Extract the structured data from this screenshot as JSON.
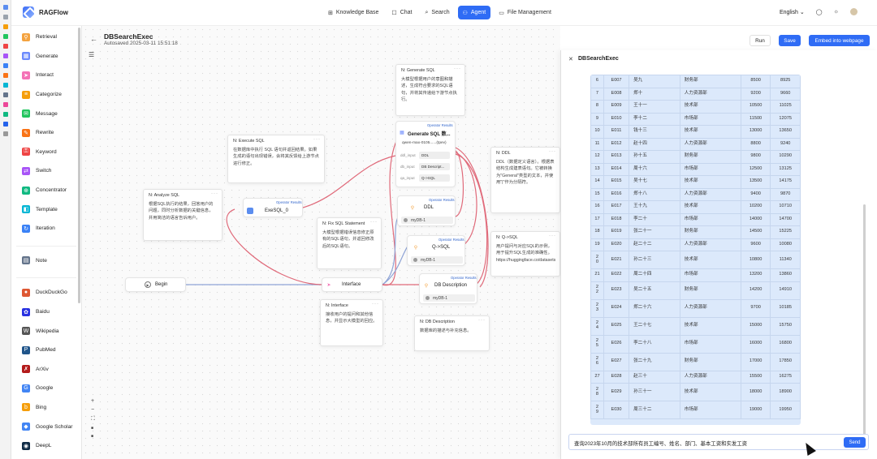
{
  "app": {
    "name": "RAGFlow"
  },
  "nav": [
    {
      "label": "Knowledge Base",
      "icon": "knowledge-base-icon",
      "active": false
    },
    {
      "label": "Chat",
      "icon": "chat-icon",
      "active": false
    },
    {
      "label": "Search",
      "icon": "search-icon",
      "active": false
    },
    {
      "label": "Agent",
      "icon": "agent-icon",
      "active": true
    },
    {
      "label": "File Management",
      "icon": "file-icon",
      "active": false
    }
  ],
  "header_right": {
    "language": "English"
  },
  "sidebar": {
    "items": [
      {
        "label": "Retrieval",
        "color": "#f4a340",
        "glyph": "⚲"
      },
      {
        "label": "Generate",
        "color": "#6b8afd",
        "glyph": "▦"
      },
      {
        "label": "Interact",
        "color": "#f472b6",
        "glyph": "➤"
      },
      {
        "label": "Categorize",
        "color": "#f59e0b",
        "glyph": "≡"
      },
      {
        "label": "Message",
        "color": "#22c55e",
        "glyph": "✉"
      },
      {
        "label": "Rewrite",
        "color": "#f97316",
        "glyph": "✎"
      },
      {
        "label": "Keyword",
        "color": "#ef4444",
        "glyph": "⚿"
      },
      {
        "label": "Switch",
        "color": "#a855f7",
        "glyph": "⇄"
      },
      {
        "label": "Concentrator",
        "color": "#10b981",
        "glyph": "⊕"
      },
      {
        "label": "Template",
        "color": "#06b6d4",
        "glyph": "◧"
      },
      {
        "label": "Iteration",
        "color": "#3b82f6",
        "glyph": "↻"
      }
    ],
    "note_item": {
      "label": "Note",
      "color": "#64748b",
      "glyph": "▤"
    },
    "tools": [
      {
        "label": "DuckDuckGo",
        "color": "#de5833",
        "glyph": "●"
      },
      {
        "label": "Baidu",
        "color": "#2932e1",
        "glyph": "✿"
      },
      {
        "label": "Wikipedia",
        "color": "#555555",
        "glyph": "W"
      },
      {
        "label": "PubMed",
        "color": "#20558a",
        "glyph": "P"
      },
      {
        "label": "ArXiv",
        "color": "#b31b1b",
        "glyph": "✗"
      },
      {
        "label": "Google",
        "color": "#4285f4",
        "glyph": "G"
      },
      {
        "label": "Bing",
        "color": "#f59e0b",
        "glyph": "b"
      },
      {
        "label": "Google Scholar",
        "color": "#4285f4",
        "glyph": "◆"
      },
      {
        "label": "DeepL",
        "color": "#0f2b46",
        "glyph": "◉"
      }
    ]
  },
  "canvas": {
    "title": "DBSearchExec",
    "autosaved": "Autosaved 2025-03-11 15:51:18",
    "buttons": {
      "run": "Run",
      "save": "Save",
      "embed": "Embed into webpage"
    },
    "zoom_controls": {
      "plus": "+",
      "minus": "−",
      "fit": "⛶",
      "lock": "🔒"
    }
  },
  "nodes": {
    "begin": {
      "label": "Begin"
    },
    "interface": {
      "label": "Interface"
    },
    "execsql": {
      "badge": "Operator Results",
      "label": "ExeSQL_0"
    },
    "generate": {
      "badge": "Operator Results",
      "label": "Generate SQL 数...",
      "model": "qwen-max-0105......(tpev)",
      "rows": [
        {
          "k": "ddl_input",
          "v": "DDL"
        },
        {
          "k": "db_input",
          "v": "DB Descript..."
        },
        {
          "k": "qa_input",
          "v": "Q->SQL"
        }
      ]
    },
    "ddl": {
      "badge": "Operator Results",
      "label": "DDL",
      "sub": "myDB-1"
    },
    "qsql": {
      "badge": "Operator Results",
      "label": "Q->SQL",
      "sub": "myDB-1"
    },
    "dbdesc": {
      "badge": "Operator Results",
      "label": "DB Description",
      "sub": "myDB-1"
    }
  },
  "notes": {
    "generate_sql": {
      "head": "N: Generate SQL",
      "body": "大模型根据用户的意图和描述，生成符合要求的SQL语句，并将其传递给下游节点执行。"
    },
    "execute_sql": {
      "head": "N: Execute SQL",
      "body": "在数据库中执行 SQL 语句并返回结果。如果生成的语句出现错误，会将其反馈给上游节点进行修正。"
    },
    "analyze_sql": {
      "head": "N: Analyze SQL",
      "body": "根据SQL执行的结果，回答用户的问题，同时分析数据的关键信息，并用简洁的语言告诉用户。"
    },
    "fix_sql": {
      "head": "N: Fix SQL Statement",
      "body": "大模型根据错误信息修正原有的SQL语句，并返回修改后的SQL语句。"
    },
    "interface": {
      "head": "N: Interface",
      "body": "接收用户的提问和其他信息，并显示大模型的回应。"
    },
    "ddl": {
      "head": "N: DDL",
      "body": "DDL（数据定义语言）。根据表结构生成建表语句。它被转换为\"General\"类型的文本，并使用\"|\"作为分隔符。"
    },
    "qsql": {
      "head": "N: Q->SQL",
      "body": "用户提问与对应SQL的示例，用于提升SQL生成的准确性。https://huggingface.co/datasets"
    },
    "db_description": {
      "head": "N: DB Description",
      "body": "数据库的描述与补充信息。"
    }
  },
  "chat": {
    "title": "DBSearchExec",
    "rows": [
      [
        "6",
        "E007",
        "吴九",
        "财务部",
        "8500",
        "8925"
      ],
      [
        "7",
        "E008",
        "郑十",
        "人力资源部",
        "9200",
        "9660"
      ],
      [
        "8",
        "E009",
        "王十一",
        "技术部",
        "10500",
        "11025"
      ],
      [
        "9",
        "E010",
        "李十二",
        "市场部",
        "11500",
        "12075"
      ],
      [
        "10",
        "E011",
        "钱十三",
        "技术部",
        "13000",
        "13650"
      ],
      [
        "11",
        "E012",
        "赵十四",
        "人力资源部",
        "8800",
        "9240"
      ],
      [
        "12",
        "E013",
        "孙十五",
        "财务部",
        "9800",
        "10290"
      ],
      [
        "13",
        "E014",
        "周十六",
        "市场部",
        "12500",
        "13125"
      ],
      [
        "14",
        "E015",
        "吴十七",
        "技术部",
        "13500",
        "14175"
      ],
      [
        "15",
        "E016",
        "郑十八",
        "人力资源部",
        "9400",
        "9870"
      ],
      [
        "16",
        "E017",
        "王十九",
        "技术部",
        "10200",
        "10710"
      ],
      [
        "17",
        "E018",
        "李二十",
        "市场部",
        "14000",
        "14700"
      ],
      [
        "18",
        "E019",
        "张二十一",
        "财务部",
        "14500",
        "15225"
      ],
      [
        "19",
        "E020",
        "赵二十二",
        "人力资源部",
        "9600",
        "10080"
      ],
      [
        "2\n0",
        "E021",
        "孙二十三",
        "技术部",
        "10800",
        "11340"
      ],
      [
        "21",
        "E022",
        "周二十四",
        "市场部",
        "13200",
        "13860"
      ],
      [
        "2\n2",
        "E023",
        "吴二十五",
        "财务部",
        "14200",
        "14910"
      ],
      [
        "2\n3",
        "E024",
        "郑二十六",
        "人力资源部",
        "9700",
        "10185"
      ],
      [
        "2\n4",
        "E025",
        "王二十七",
        "技术部",
        "15000",
        "15750"
      ],
      [
        "2\n5",
        "E026",
        "李二十八",
        "市场部",
        "16000",
        "16800"
      ],
      [
        "2\n6",
        "E027",
        "张二十九",
        "财务部",
        "17000",
        "17850"
      ],
      [
        "27",
        "E028",
        "赵三十",
        "人力资源部",
        "15500",
        "16275"
      ],
      [
        "2\n8",
        "E029",
        "孙三十一",
        "技术部",
        "18000",
        "18900"
      ],
      [
        "2\n9",
        "E030",
        "周三十二",
        "市场部",
        "19000",
        "19950"
      ]
    ],
    "input_value": "查询2023年10月的技术部所有员工编号、姓名、部门、基本工资和实发工资",
    "send_label": "Send"
  }
}
